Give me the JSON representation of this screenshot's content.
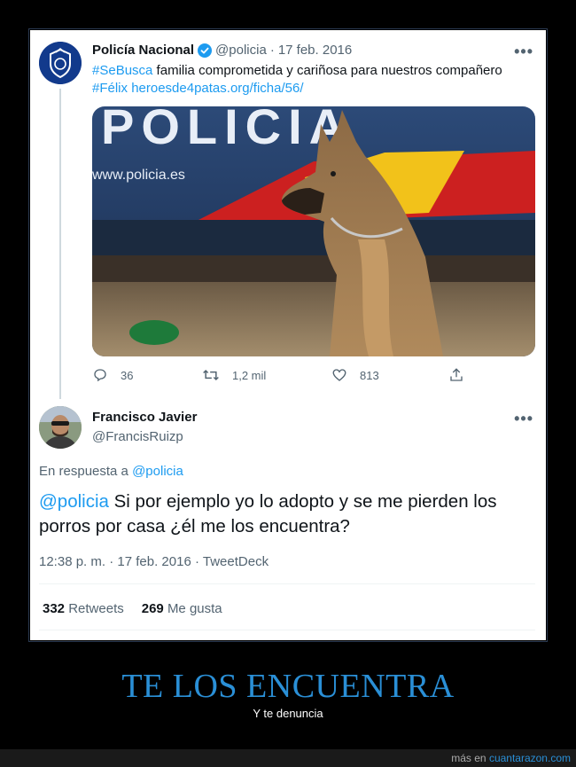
{
  "tweet1": {
    "author_name": "Policía Nacional",
    "handle": "@policia",
    "separator": "·",
    "date": "17 feb. 2016",
    "more": "•••",
    "hashtag1": "#SeBusca",
    "text_line1": " familia comprometida y cariñosa para nuestros compañero",
    "hashtag2": "#Félix",
    "url": "heroesde4patas.org/ficha/56/",
    "photo_text_big": "POLICIA",
    "photo_text_url": "www.policia.es",
    "actions": {
      "replies": "36",
      "retweets": "1,2 mil",
      "likes": "813"
    }
  },
  "tweet2": {
    "author_name": "Francisco Javier",
    "handle": "@FrancisRuizp",
    "more": "•••",
    "reply_prefix": "En respuesta a ",
    "reply_handle": "@policia",
    "mention": "@policia",
    "text": " Si por ejemplo yo lo adopto y se me pierden los porros por casa ¿él me los encuentra?",
    "time": "12:38 p. m.",
    "separator": "·",
    "date": "17 feb. 2016",
    "client": "TweetDeck",
    "retweets_count": "332",
    "retweets_label": "Retweets",
    "likes_count": "269",
    "likes_label": "Me gusta"
  },
  "caption": {
    "title": "TE LOS ENCUENTRA",
    "subtitle": "Y te denuncia"
  },
  "footer": {
    "prefix": "más en ",
    "site": "cuantarazon.com"
  },
  "colors": {
    "link": "#1d9bf0",
    "caption_title": "#2a8fd6",
    "verified": "#1d9bf0"
  }
}
